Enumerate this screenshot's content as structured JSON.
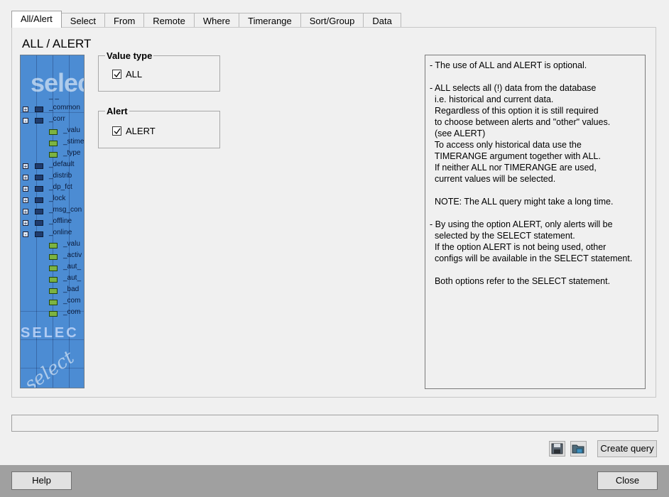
{
  "tabs": [
    "All/Alert",
    "Select",
    "From",
    "Remote",
    "Where",
    "Timerange",
    "Sort/Group",
    "Data"
  ],
  "page_title": "ALL / ALERT",
  "image": {
    "text_top": "selec",
    "text_mid": "SELEC",
    "text_script": "select",
    "tree": [
      {
        "label": "_ _",
        "type": "header"
      },
      {
        "label": "_common",
        "type": "node",
        "expander": "+"
      },
      {
        "label": "_corr",
        "type": "node",
        "expander": "-"
      },
      {
        "label": "_valu",
        "type": "leaf"
      },
      {
        "label": "_stime",
        "type": "leaf"
      },
      {
        "label": "_type",
        "type": "leaf"
      },
      {
        "label": "_default",
        "type": "node",
        "expander": "+"
      },
      {
        "label": "_distrib",
        "type": "node",
        "expander": "+"
      },
      {
        "label": "_dp_fct",
        "type": "node",
        "expander": "+"
      },
      {
        "label": "_lock",
        "type": "node",
        "expander": "+"
      },
      {
        "label": "_msg_con",
        "type": "node",
        "expander": "+"
      },
      {
        "label": "_offline",
        "type": "node",
        "expander": "+"
      },
      {
        "label": "_online",
        "type": "node",
        "expander": "-"
      },
      {
        "label": "_valu",
        "type": "leaf"
      },
      {
        "label": "_activ",
        "type": "leaf"
      },
      {
        "label": "_aut_",
        "type": "leaf"
      },
      {
        "label": "_aut_",
        "type": "leaf"
      },
      {
        "label": "_bad",
        "type": "leaf"
      },
      {
        "label": "_com",
        "type": "leaf"
      },
      {
        "label": "_com",
        "type": "leaf"
      }
    ]
  },
  "value_type": {
    "legend": "Value type",
    "all_label": "ALL",
    "all_checked": true
  },
  "alert": {
    "legend": "Alert",
    "alert_label": "ALERT",
    "alert_checked": true
  },
  "info_text": "- The use of ALL and ALERT is optional.\n\n- ALL selects all (!) data from the database\n  i.e. historical and current data.\n  Regardless of this option it is still required\n  to choose between alerts and \"other\" values.\n  (see ALERT)\n  To access only historical data use the\n  TIMERANGE argument together with ALL.\n  If neither ALL nor TIMERANGE are used,\n  current values will be selected.\n\n  NOTE: The ALL query might take a long time.\n\n- By using the option ALERT, only alerts will be\n  selected by the SELECT statement.\n  If the option ALERT is not being used, other\n  configs will be available in the SELECT statement.\n\n  Both options refer to the SELECT statement.",
  "status_text": "",
  "buttons": {
    "create_query": "Create query",
    "help": "Help",
    "close": "Close"
  },
  "icons": {
    "save": "save-icon",
    "load": "open-folder-icon"
  }
}
